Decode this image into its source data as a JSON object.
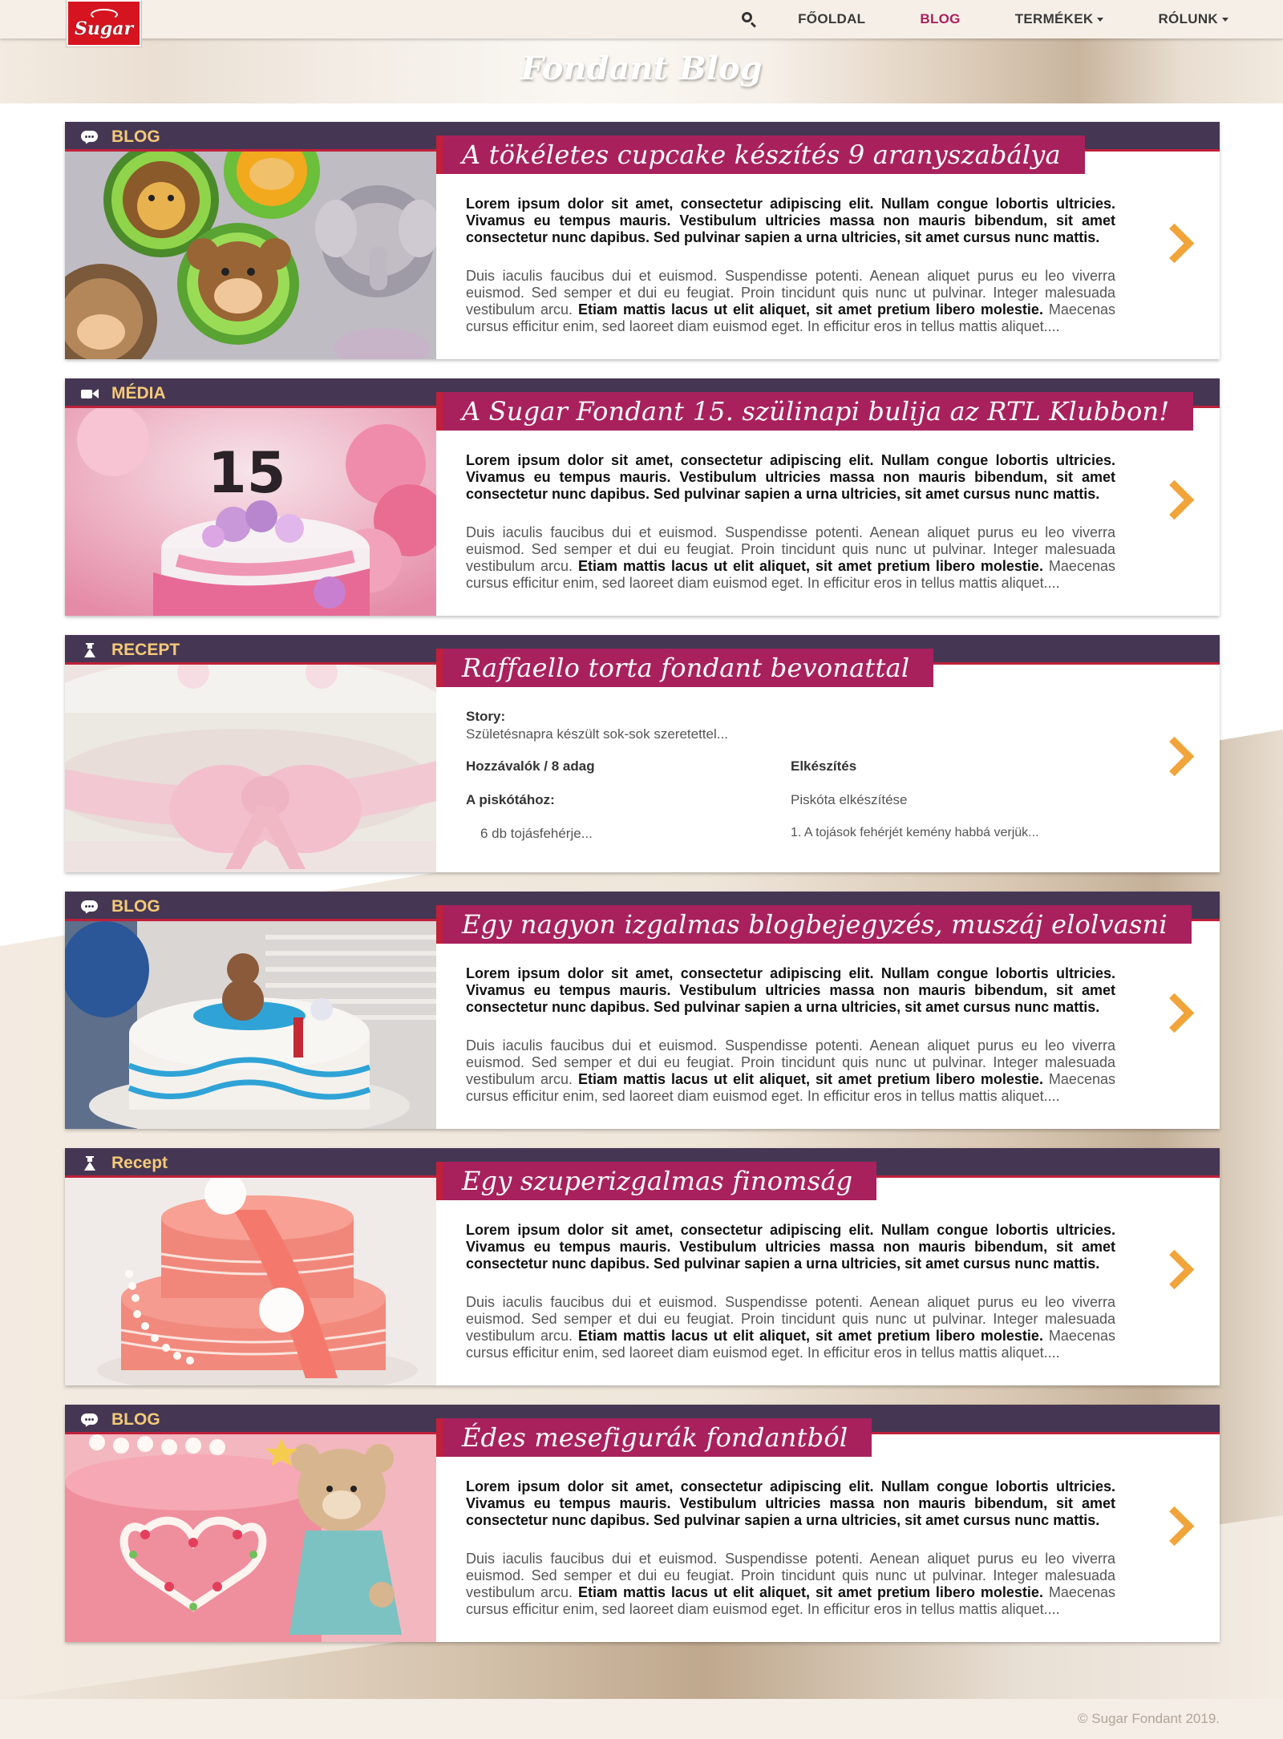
{
  "brand": {
    "logo_text": "Sugar"
  },
  "nav": {
    "items": [
      {
        "label": "FŐOLDAL"
      },
      {
        "label": "BLOG"
      },
      {
        "label": "TERMÉKEK"
      },
      {
        "label": "RÓLUNK"
      }
    ]
  },
  "hero": {
    "title": "Fondant Blog"
  },
  "posts": [
    {
      "category": "BLOG",
      "category_icon": "chat-bubble-icon",
      "title": "A tökéletes cupcake készítés 9 aranyszabálya",
      "lead": "Lorem ipsum dolor sit amet, consectetur adipiscing elit. Nullam congue lobortis ultricies. Vivamus eu tempus mauris. Vestibulum ultricies massa non mauris bibendum, sit amet consectetur nunc dapibus. Sed pulvinar sapien a urna ultricies, sit amet cursus nunc mattis.",
      "rest_a": "Duis iaculis faucibus dui et euismod. Suspendisse potenti. Aenean aliquet purus eu leo viverra euismod. Sed semper et dui eu feugiat. Proin tincidunt quis nunc ut pulvinar. Integer malesuada vestibulum arcu. ",
      "rest_bold": "Etiam mattis lacus ut elit aliquet, sit amet pretium libero molestie.",
      "rest_b": " Maecenas cursus efficitur enim, sed laoreet diam euismod eget. In efficitur eros in tellus mattis aliquet...."
    },
    {
      "category": "MÉDIA",
      "category_icon": "video-camera-icon",
      "title": "A Sugar Fondant 15. szülinapi bulija az RTL Klubbon!",
      "lead": "Lorem ipsum dolor sit amet, consectetur adipiscing elit. Nullam congue lobortis ultricies. Vivamus eu tempus mauris. Vestibulum ultricies massa non mauris bibendum, sit amet consectetur nunc dapibus. Sed pulvinar sapien a urna ultricies, sit amet cursus nunc mattis.",
      "rest_a": "Duis iaculis faucibus dui et euismod. Suspendisse potenti. Aenean aliquet purus eu leo viverra euismod. Sed semper et dui eu feugiat. Proin tincidunt quis nunc ut pulvinar. Integer malesuada vestibulum arcu. ",
      "rest_bold": "Etiam mattis lacus ut elit aliquet, sit amet pretium libero molestie.",
      "rest_b": " Maecenas cursus efficitur enim, sed laoreet diam euismod eget. In efficitur eros in tellus mattis aliquet...."
    },
    {
      "category": "RECEPT",
      "category_icon": "flask-icon",
      "title": "Raffaello torta fondant bevonattal",
      "story_label": "Story:",
      "story": "Születésnapra készült sok-sok szeretettel...",
      "ingredients_header": "Hozzávalók / 8 adag",
      "ingredients_sub": "A piskótához:",
      "ingredients_item": "6 db tojásfehérje...",
      "prep_header": "Elkészítés",
      "prep_sub": "Piskóta elkészítése",
      "prep_item": "1. A tojások fehérjét kemény habbá verjük..."
    },
    {
      "category": "BLOG",
      "category_icon": "chat-bubble-icon",
      "title": "Egy nagyon izgalmas blogbejegyzés, muszáj elolvasni",
      "lead": "Lorem ipsum dolor sit amet, consectetur adipiscing elit. Nullam congue lobortis ultricies. Vivamus eu tempus mauris. Vestibulum ultricies massa non mauris bibendum, sit amet consectetur nunc dapibus. Sed pulvinar sapien a urna ultricies, sit amet cursus nunc mattis.",
      "rest_a": "Duis iaculis faucibus dui et euismod. Suspendisse potenti. Aenean aliquet purus eu leo viverra euismod. Sed semper et dui eu feugiat. Proin tincidunt quis nunc ut pulvinar. Integer malesuada vestibulum arcu. ",
      "rest_bold": "Etiam mattis lacus ut elit aliquet, sit amet pretium libero molestie.",
      "rest_b": " Maecenas cursus efficitur enim, sed laoreet diam euismod eget. In efficitur eros in tellus mattis aliquet...."
    },
    {
      "category": "Recept",
      "category_icon": "flask-icon",
      "title": "Egy szuperizgalmas finomság",
      "lead": "Lorem ipsum dolor sit amet, consectetur adipiscing elit. Nullam congue lobortis ultricies. Vivamus eu tempus mauris. Vestibulum ultricies massa non mauris bibendum, sit amet consectetur nunc dapibus. Sed pulvinar sapien a urna ultricies, sit amet cursus nunc mattis.",
      "rest_a": "Duis iaculis faucibus dui et euismod. Suspendisse potenti. Aenean aliquet purus eu leo viverra euismod. Sed semper et dui eu feugiat. Proin tincidunt quis nunc ut pulvinar. Integer malesuada vestibulum arcu. ",
      "rest_bold": "Etiam mattis lacus ut elit aliquet, sit amet pretium libero molestie.",
      "rest_b": " Maecenas cursus efficitur enim, sed laoreet diam euismod eget. In efficitur eros in tellus mattis aliquet...."
    },
    {
      "category": "BLOG",
      "category_icon": "chat-bubble-icon",
      "title": "Édes mesefigurák fondantból",
      "lead": "Lorem ipsum dolor sit amet, consectetur adipiscing elit. Nullam congue lobortis ultricies. Vivamus eu tempus mauris. Vestibulum ultricies massa non mauris bibendum, sit amet consectetur nunc dapibus. Sed pulvinar sapien a urna ultricies, sit amet cursus nunc mattis.",
      "rest_a": "Duis iaculis faucibus dui et euismod. Suspendisse potenti. Aenean aliquet purus eu leo viverra euismod. Sed semper et dui eu feugiat. Proin tincidunt quis nunc ut pulvinar. Integer malesuada vestibulum arcu. ",
      "rest_bold": "Etiam mattis lacus ut elit aliquet, sit amet pretium libero molestie.",
      "rest_b": " Maecenas cursus efficitur enim, sed laoreet diam euismod eget. In efficitur eros in tellus mattis aliquet...."
    }
  ],
  "footer": {
    "copyright": "© Sugar Fondant 2019."
  },
  "colors": {
    "band": "#453753",
    "title_bg": "#a8215d",
    "accent_red": "#c0203a",
    "category_text": "#f4c979",
    "arrow": "#f1a43a",
    "nav_active": "#a8215d"
  }
}
